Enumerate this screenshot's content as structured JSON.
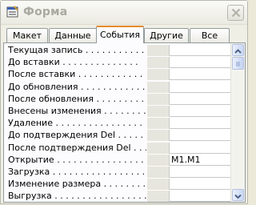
{
  "window": {
    "title": "Форма",
    "icon": "properties-sheet-icon",
    "close_icon": "close-icon"
  },
  "tabs": [
    {
      "label": "Макет",
      "active": false
    },
    {
      "label": "Данные",
      "active": false
    },
    {
      "label": "События",
      "active": true
    },
    {
      "label": "Другие",
      "active": false
    },
    {
      "label": "Все",
      "active": false
    }
  ],
  "properties": [
    {
      "label": "Текущая запись . . . . . . . . . . .",
      "value": ""
    },
    {
      "label": "До вставки . . . . . . . . . . . . . .",
      "value": ""
    },
    {
      "label": "После вставки . . . . . . . . . . . .",
      "value": ""
    },
    {
      "label": "До обновления . . . . . . . . . . . .",
      "value": ""
    },
    {
      "label": "После обновления . . . . . . . . . .",
      "value": ""
    },
    {
      "label": "Внесены изменения . . . . . . . . .",
      "value": ""
    },
    {
      "label": "Удаление . . . . . . . . . . . . . . . .",
      "value": ""
    },
    {
      "label": "До подтверждения Del . . . . . . .",
      "value": ""
    },
    {
      "label": "После подтверждения Del . . . . .",
      "value": ""
    },
    {
      "label": "Открытие . . . . . . . . . . . . . . . .",
      "value": "M1.M1"
    },
    {
      "label": "Загрузка . . . . . . . . . . . . . . . . .",
      "value": ""
    },
    {
      "label": "Изменение размера . . . . . . . . .",
      "value": ""
    },
    {
      "label": "Выгрузка . . . . . . . . . . . . . . . . .",
      "value": ""
    }
  ],
  "scrollbar": {
    "up_icon": "chevron-up-icon",
    "down_icon": "chevron-down-icon"
  }
}
